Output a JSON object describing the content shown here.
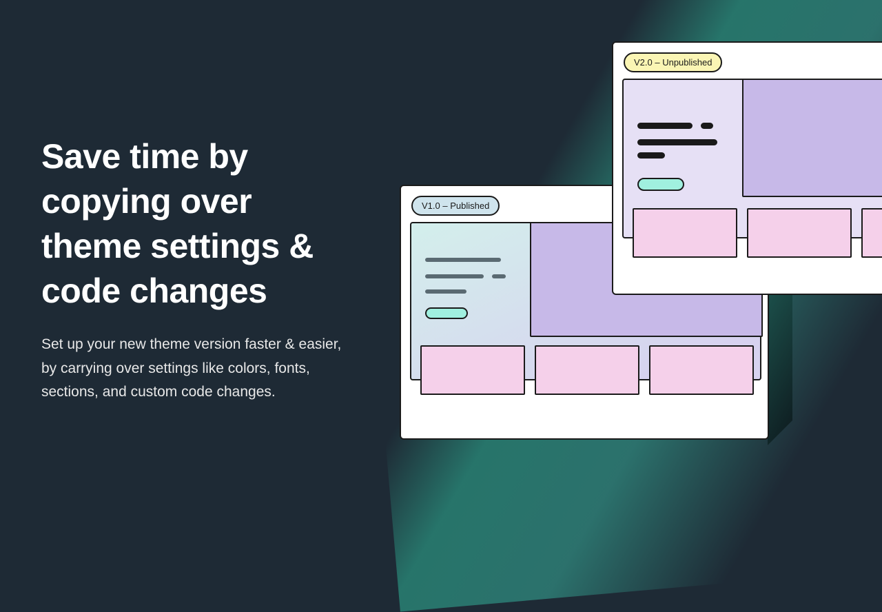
{
  "text": {
    "headline": "Save time by copying over theme settings & code changes",
    "subtext": "Set up your new theme version faster & easier, by carrying over settings like colors, fonts, sections, and custom code changes."
  },
  "badges": {
    "back": "V1.0 – Published",
    "front": "V2.0 – Unpublished"
  }
}
